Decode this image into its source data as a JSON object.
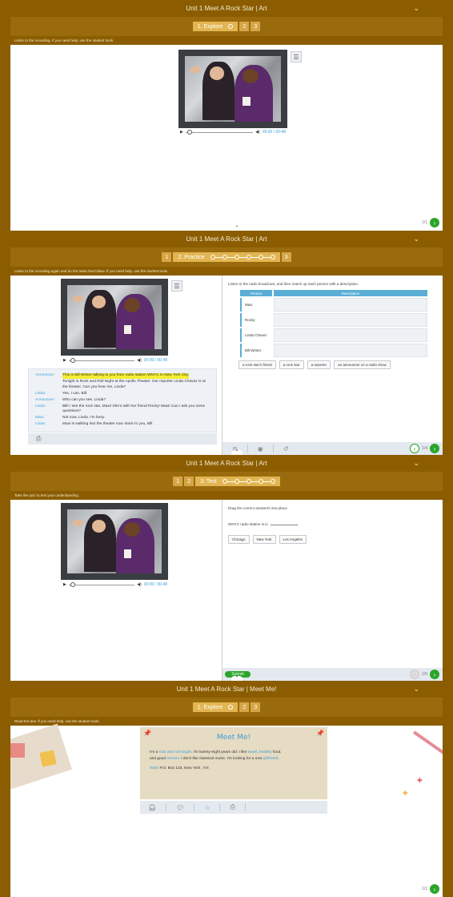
{
  "screen1": {
    "title": "Unit 1 Meet A Rock Star | Art",
    "steps": {
      "active": "1. Explore",
      "s2": "2",
      "s3": "3"
    },
    "instruction": "Listen to the recording. If you need help, use the student tools.",
    "audio": {
      "time": "00:00 / 00:48"
    },
    "pager": "1/1"
  },
  "screen2": {
    "title": "Unit 1 Meet A Rock Star | Art",
    "steps": {
      "s1": "1",
      "active": "2. Practice",
      "s3": "3"
    },
    "instruction": "Listen to the recording again and do the tasks that follow. If you need help, use the student tools.",
    "audio": {
      "time": "00:00 / 00:48"
    },
    "transcript": [
      {
        "speaker": "Announcer:",
        "text": "This is Bill Winter talking to you from radio station WNYC in New York City.",
        "highlight": true
      },
      {
        "speaker": "",
        "text": "Tonight is Rock and Roll Night at the Apollo Theater. Our reporter Linda Chavez is at the theater. Can you hear me, Linda?",
        "highlight": false
      },
      {
        "speaker": "Linda:",
        "text": "Yes, I can, Bill.",
        "highlight": false
      },
      {
        "speaker": "Announcer:",
        "text": "Who can you see, Linda?",
        "highlight": false
      },
      {
        "speaker": "Linda:",
        "text": "Bill! I see the rock star, Maxi! She's with her friend Rocky! Maxi! Can I ask you some questions?",
        "highlight": false
      },
      {
        "speaker": "Maxi:",
        "text": "Not now, Linda. I'm busy.",
        "highlight": false
      },
      {
        "speaker": "Linda:",
        "text": "Maxi is walking into the theater now. Back to you, Bill.",
        "highlight": false
      }
    ],
    "task_instruction": "Listen to the radio broadcast, and then match up each person with a description.",
    "table": {
      "head_person": "Person",
      "head_desc": "Description",
      "people": [
        "Maxi",
        "Rocky",
        "Linda Chavez",
        "Bill Winter"
      ]
    },
    "options": [
      "a rock star's friend",
      "a rock star",
      "a reporter",
      "an announcer on a radio show"
    ],
    "pager": "1/4"
  },
  "screen3": {
    "title": "Unit 1 Meet A Rock Star | Art",
    "steps": {
      "s1": "1",
      "s2": "2",
      "active": "3. Test"
    },
    "instruction": "Take the quiz to test your understanding.",
    "audio": {
      "time": "00:00 / 00:48"
    },
    "task_instruction": "Drag the correct answer/s into place.",
    "question_prefix": "WNYC radio station is in",
    "question_suffix": ".",
    "options": [
      "Chicago",
      "New York",
      "Los Angeles"
    ],
    "submit": "Submit",
    "pager": "1/5"
  },
  "screen4": {
    "title": "Unit 1 Meet A Rock Star | Meet Me!",
    "steps": {
      "active": "1. Explore",
      "s2": "2",
      "s3": "3"
    },
    "instruction": "Read the text. If you need help, use the student tools.",
    "card_title": "Meet Me!",
    "line1": {
      "a": "I'm a ",
      "k1": "rock and roll singer",
      "b": ". I'm twenty-eight years old. I like ",
      "k2": "travel",
      "c": ", ",
      "k3": "healthy",
      "d": " food,"
    },
    "line2": {
      "a": "and good ",
      "k1": "movies",
      "b": ". I don't like classical music. I'm looking for a new ",
      "k2": "girlfriend",
      "c": "."
    },
    "line3": {
      "k1": "Write",
      "a": " P.O. Box 123, New York , NY."
    },
    "pager": "1/1"
  },
  "colors": {
    "brown": "#8b5d00",
    "step_gold": "#d6a646",
    "blue": "#3a9fd6",
    "green": "#2aa52a",
    "highlight": "#f4ee32"
  }
}
